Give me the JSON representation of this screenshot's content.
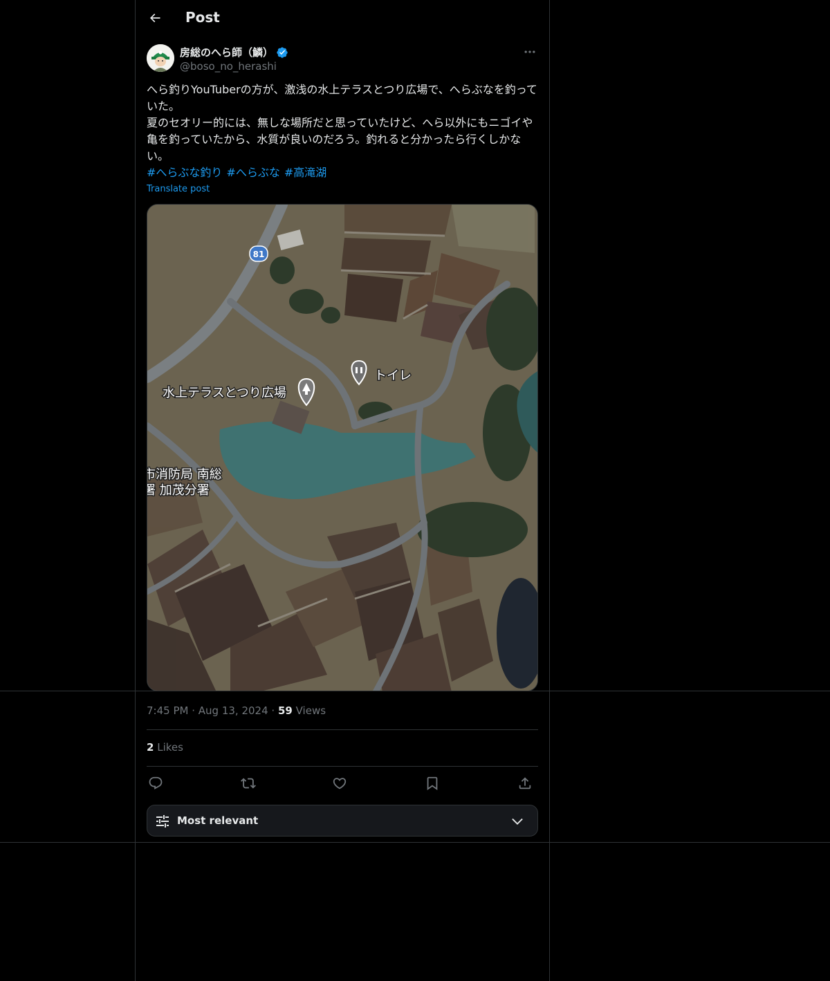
{
  "header": {
    "title": "Post"
  },
  "author": {
    "name": "房総のへら師（鱗）",
    "handle": "@boso_no_herashi"
  },
  "post": {
    "lines": [
      "へら釣りYouTuberの方が、激浅の水上テラスとつり広場で、へらぶなを釣っていた。",
      "夏のセオリー的には、無しな場所だと思っていたけど、へら以外にもニゴイや亀を釣っていたから、水質が良いのだろう。釣れると分かったら行くしかない。"
    ],
    "hashtags": [
      "#へらぶな釣り",
      "#へらぶな",
      "#高滝湖"
    ],
    "translate_label": "Translate post"
  },
  "map": {
    "route_badge": "81",
    "label_terrace": "水上テラスとつり広場",
    "label_toilet": "トイレ",
    "label_fire_1": "市消防局 南総",
    "label_fire_2": "署 加茂分署"
  },
  "meta": {
    "time": "7:45 PM",
    "date": "Aug 13, 2024",
    "views_count": "59",
    "views_label": "Views"
  },
  "likes": {
    "count": "2",
    "label": "Likes"
  },
  "sort": {
    "label": "Most relevant"
  },
  "colors": {
    "accent": "#1d9bf0",
    "background": "#000000",
    "border": "#2f3336",
    "muted": "#71767b"
  }
}
